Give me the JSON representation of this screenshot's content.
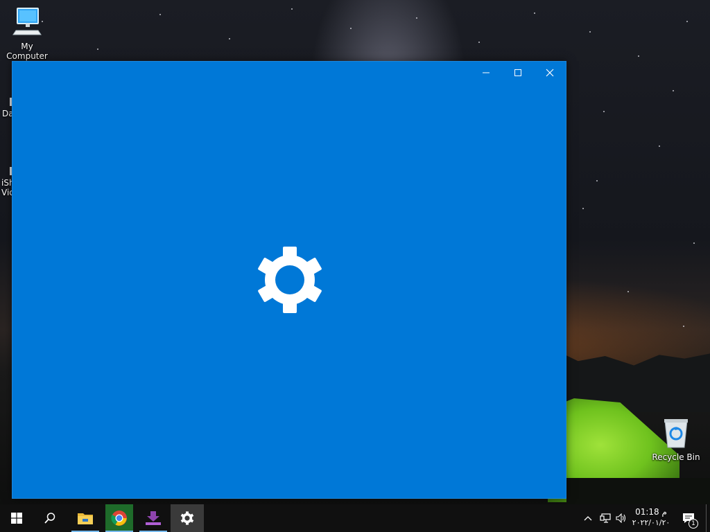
{
  "desktop": {
    "icons": [
      {
        "label": "My Computer",
        "icon": "computer-icon"
      },
      {
        "label": "Recycle Bin",
        "icon": "recycle-bin-icon"
      }
    ],
    "partial_labels": [
      "Da",
      "iSh",
      "Vic"
    ]
  },
  "window": {
    "background": "#0078d7",
    "splash_icon": "settings-gear-icon",
    "controls": [
      "minimize-icon",
      "maximize-icon",
      "close-icon"
    ]
  },
  "taskbar": {
    "apps": [
      {
        "name": "start",
        "icon": "windows-logo-icon"
      },
      {
        "name": "search",
        "icon": "search-icon"
      },
      {
        "name": "file-explorer",
        "icon": "folder-icon"
      },
      {
        "name": "chrome",
        "icon": "chrome-icon"
      },
      {
        "name": "downloader",
        "icon": "download-icon"
      },
      {
        "name": "settings",
        "icon": "gear-icon"
      }
    ],
    "clock": {
      "time": "م 01:18",
      "date": "٢٠٢٢/٠١/٢٠"
    },
    "notification_count": "1"
  }
}
